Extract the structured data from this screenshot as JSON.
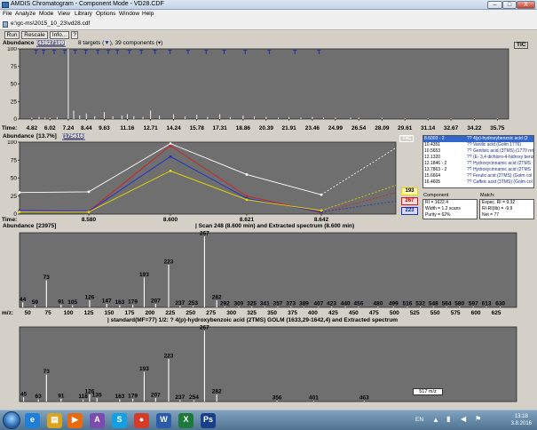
{
  "window": {
    "title": "AMDIS Chromatogram - Component Mode - VD28.CDF",
    "buttons": {
      "minimize": "–",
      "maximize": "□",
      "close": "X"
    }
  },
  "menu": [
    "File",
    "Analyze",
    "Mode",
    "View",
    "Library",
    "Options",
    "Window",
    "Help"
  ],
  "path": "e:\\gc-ms\\2015_10_23\\vd28.cdf",
  "toolbar": {
    "run": "Run",
    "rescale": "Rescale",
    "info": "Info...",
    "extra": "?"
  },
  "panel1": {
    "label": "Abundance",
    "value": "[43827199]",
    "summary": "8 targets (",
    "summary_arrow": "▼",
    "summary_rest": "), 39 components (",
    "summary_arrow2": "▾",
    "summary_end": ")",
    "badge": "TIC",
    "y_ticks": [
      "100",
      "75",
      "50",
      "25",
      "0"
    ],
    "x_label": "Time:",
    "x_ticks": [
      "4.82",
      "6.02",
      "7.24",
      "8.44",
      "9.63",
      "11.16",
      "12.71",
      "14.24",
      "15.78",
      "17.31",
      "18.86",
      "20.39",
      "21.91",
      "23.46",
      "24.99",
      "26.54",
      "28.09",
      "29.61",
      "31.14",
      "32.67",
      "34.22",
      "35.75"
    ]
  },
  "panel2": {
    "label": "Abundance",
    "value": "[13.7%]",
    "value2": "[175616]",
    "badge": "TIC",
    "y_ticks": [
      "100",
      "75",
      "50",
      "25",
      "0"
    ],
    "x_label": "Time:",
    "x_ticks": [
      "8.580",
      "8.600",
      "8.621",
      "8.642"
    ],
    "ion_badges": [
      {
        "text": "193",
        "color": "#e8d800"
      },
      {
        "text": "267",
        "color": "#d42020"
      },
      {
        "text": "223",
        "color": "#2030c8"
      }
    ]
  },
  "chart_data": [
    {
      "type": "bar",
      "title": "TIC",
      "xlabel": "Time:",
      "ylabel": "Abundance",
      "ylim": [
        0,
        100
      ],
      "x": [
        4.82,
        5.3,
        5.7,
        6.02,
        6.5,
        7.24,
        7.6,
        8.0,
        8.44,
        9.0,
        9.63,
        10.2,
        10.8,
        11.16,
        11.6,
        12.2,
        12.71,
        13.3,
        14.24,
        15.0,
        15.78,
        16.5,
        17.31,
        18.0,
        18.86,
        19.6,
        20.39,
        21.2,
        21.91,
        22.7,
        23.46,
        24.2,
        24.99,
        26.0,
        26.54,
        28.09,
        29.61,
        31.14,
        32.67,
        34.22,
        35.75
      ],
      "values": [
        2,
        3,
        2,
        2,
        3,
        100,
        12,
        5,
        8,
        4,
        10,
        4,
        5,
        7,
        4,
        3,
        12,
        5,
        7,
        4,
        6,
        3,
        7,
        3,
        5,
        4,
        3,
        2,
        3,
        2,
        3,
        2,
        2,
        2,
        2,
        2,
        1,
        1,
        1,
        1,
        1
      ]
    },
    {
      "type": "line",
      "title": "",
      "xlabel": "Time:",
      "ylabel": "Abundance",
      "ylim": [
        0,
        100
      ],
      "categories": [
        "8.568",
        "8.580",
        "8.600",
        "8.621",
        "8.642",
        "8.663"
      ],
      "series": [
        {
          "name": "TIC",
          "color": "#ffffff",
          "values": [
            30,
            31,
            98,
            55,
            27,
            92
          ]
        },
        {
          "name": "267",
          "color": "#d42020",
          "values": [
            5,
            4,
            95,
            25,
            2,
            30
          ]
        },
        {
          "name": "223",
          "color": "#2030c8",
          "values": [
            5,
            4,
            80,
            22,
            3,
            18
          ]
        },
        {
          "name": "193",
          "color": "#e8d800",
          "values": [
            3,
            3,
            60,
            20,
            5,
            40
          ]
        }
      ]
    },
    {
      "type": "bar",
      "title": "Scan 248 (8.600 min) and Extracted spectrum (8.600 min)",
      "xlabel": "m/z:",
      "ylabel": "Abundance",
      "value": "[23975]",
      "ylim": [
        0,
        100
      ],
      "xlim": [
        40,
        650
      ],
      "x": [
        44,
        59,
        73,
        91,
        105,
        126,
        147,
        163,
        179,
        193,
        207,
        223,
        237,
        253,
        267,
        282,
        292,
        309,
        325,
        341,
        357,
        373,
        389,
        407,
        423,
        440,
        456,
        480,
        499,
        516,
        532,
        548,
        564,
        580,
        597,
        613,
        630
      ],
      "values": [
        7,
        3,
        38,
        4,
        3,
        10,
        5,
        3,
        4,
        42,
        5,
        60,
        2,
        2,
        100,
        10,
        1,
        1,
        1,
        1,
        1,
        1,
        1,
        1,
        1,
        1,
        1,
        1,
        1,
        1,
        1,
        1,
        1,
        1,
        1,
        1,
        1
      ],
      "x_ticks": [
        "m/z:",
        "50",
        "75",
        "100",
        "125",
        "150",
        "175",
        "200",
        "225",
        "250",
        "275",
        "300",
        "325",
        "350",
        "375",
        "400",
        "425",
        "450",
        "475",
        "500",
        "525",
        "550",
        "575",
        "600",
        "625"
      ]
    },
    {
      "type": "bar",
      "title": "standard(MF=77) 1/2: ? 4(p)-hydroxybenzoic acid (2TMS) GOLM (1633,29-1642,4) and Extracted spectrum",
      "xlabel": "m/z:",
      "ylabel": "Abundance",
      "ylim": [
        0,
        100
      ],
      "xlim": [
        40,
        650
      ],
      "x": [
        45,
        63,
        73,
        91,
        118,
        126,
        135,
        163,
        179,
        193,
        207,
        223,
        237,
        254,
        267,
        282,
        356,
        401,
        463
      ],
      "values": [
        6,
        3,
        38,
        4,
        3,
        10,
        5,
        3,
        4,
        42,
        5,
        60,
        2,
        2,
        100,
        10,
        1,
        1,
        1
      ],
      "x_ticks": [
        "m/z:",
        "50",
        "75",
        "100",
        "125",
        "150",
        "175",
        "200",
        "225",
        "250",
        "275",
        "300",
        "325",
        "350",
        "375",
        "400",
        "425",
        "450",
        "475",
        "500",
        "525",
        "550",
        "575",
        "600",
        "625"
      ]
    }
  ],
  "panel3": {
    "label": "Abundance",
    "value": "[23975]",
    "header": "| Scan 248 (8.600 min) and  Extracted spectrum (8.600 min)"
  },
  "panel4": {
    "header": "| standard(MF=77) 1/2: ? 4(p)-hydroxybenzoic acid (2TMS) GOLM (1633,29-1642,4) and  Extracted spectrum"
  },
  "mz_readout": "517 m/z",
  "component_list": [
    {
      "time": "8.6003 - 2",
      "name": "?? 4(p)-hydroxybenzoic acid (2",
      "selected": true
    },
    {
      "time": "10.4351",
      "name": "?? Vanilic acid (Golm 1776)",
      "selected": false
    },
    {
      "time": "10.5653",
      "name": "?? Gentisic acid (3TMS) (1770 ret",
      "selected": false
    },
    {
      "time": "12.1320",
      "name": "?? (E- 3,4 dichloro-4-hidroxy benz",
      "selected": false
    },
    {
      "time": "12.1846 - 2",
      "name": "?? Hydroxycinnamic acid (2TMS",
      "selected": false
    },
    {
      "time": "13.7863 - 2",
      "name": "?? Hydroxycinnamic acid (2TMS",
      "selected": false
    },
    {
      "time": "15.6664",
      "name": "?? Ferulic acid (2TMS) (Golm col",
      "selected": false
    },
    {
      "time": "16.4605",
      "name": "?? Caffeic acid (3TMS) (Golm col",
      "selected": false
    }
  ],
  "component_info": {
    "heading": "Component",
    "lines": [
      "RI = 1622.4",
      "Width = 1.2 scans",
      "Purity = 62%"
    ]
  },
  "match_info": {
    "heading": "Match:",
    "lines": [
      "Expec. RI = 9.32",
      "RI-RI(lib) = -9.9",
      "Net = 77"
    ]
  },
  "taskbar": {
    "apps": [
      {
        "name": "ie-icon",
        "glyph": "e",
        "color": "#1f7fd8"
      },
      {
        "name": "folder-icon",
        "glyph": "▤",
        "color": "#d9a520"
      },
      {
        "name": "media-player-icon",
        "glyph": "▶",
        "color": "#e86a10"
      },
      {
        "name": "amdis-icon",
        "glyph": "A",
        "color": "#7c4bb0"
      },
      {
        "name": "skype-icon",
        "glyph": "S",
        "color": "#14a0e0"
      },
      {
        "name": "chrome-icon",
        "glyph": "●",
        "color": "#d83a2a"
      },
      {
        "name": "word-icon",
        "glyph": "W",
        "color": "#2b5aa8"
      },
      {
        "name": "excel-icon",
        "glyph": "X",
        "color": "#1e7a3a"
      },
      {
        "name": "photoshop-icon",
        "glyph": "Ps",
        "color": "#1a3f8a"
      }
    ],
    "lang": "EN",
    "time": "13:18",
    "date": "3.8.2016"
  }
}
